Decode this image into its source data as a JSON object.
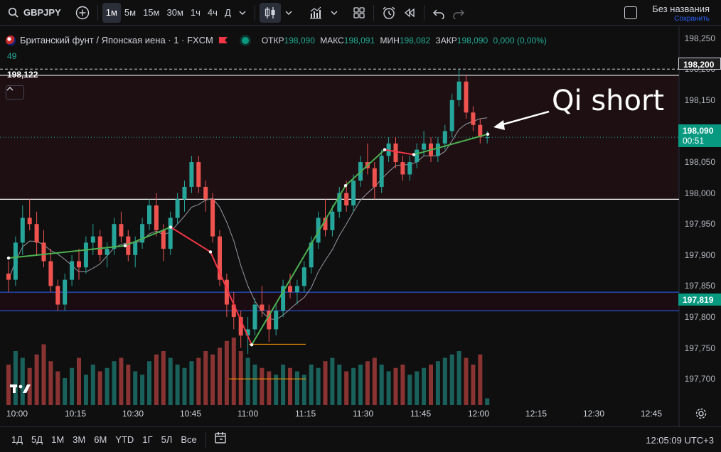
{
  "toolbar": {
    "symbol": "GBPJPY",
    "intervals": [
      "1м",
      "5м",
      "15м",
      "30м",
      "1ч",
      "4ч",
      "Д"
    ],
    "active_interval": "1м",
    "layout_title": "Без названия",
    "layout_subtitle": "Сохранить"
  },
  "legend": {
    "instrument": "Британский фунт / Японская иена · 1 · FXCM",
    "open_label": "ОТКР",
    "open": "198,090",
    "high_label": "МАКС",
    "high": "198,091",
    "low_label": "МИН",
    "low": "198,082",
    "close_label": "ЗАКР",
    "close": "198,090",
    "change": "0,000 (0,00%)",
    "volume": "49"
  },
  "level_label": "198,122",
  "annotation": "Qi short",
  "price_scale": {
    "labels": [
      "198,250",
      "198,200",
      "198,150",
      "198,100",
      "198,050",
      "198,000",
      "197,950",
      "197,900",
      "197,850",
      "197,800",
      "197,750",
      "197,700"
    ],
    "current_price": "198,090",
    "countdown": "00:51",
    "line_price": "197,819",
    "cursor_price": "198,200"
  },
  "time_axis": {
    "labels": [
      "10:00",
      "10:15",
      "10:30",
      "10:45",
      "11:00",
      "11:15",
      "11:30",
      "11:45",
      "12:00",
      "12:15",
      "12:30",
      "12:45"
    ]
  },
  "bottom": {
    "ranges": [
      "1Д",
      "5Д",
      "1М",
      "3М",
      "6М",
      "YTD",
      "1Г",
      "5Л",
      "Все"
    ],
    "clock": "12:05:09 UTC+3"
  },
  "colors": {
    "up": "#26a69a",
    "down": "#ef5350",
    "zigzag_up": "#4caf50",
    "zigzag_down": "#f23645",
    "blue_line": "#2962ff",
    "orange_line": "#ff9800"
  },
  "chart_data": {
    "type": "candlestick",
    "symbol": "GBPJPY",
    "ylim": [
      197.66,
      198.26
    ],
    "candles": [
      [
        197.87,
        197.89,
        197.84,
        197.86
      ],
      [
        197.86,
        197.93,
        197.85,
        197.92
      ],
      [
        197.92,
        197.98,
        197.9,
        197.96
      ],
      [
        197.96,
        197.99,
        197.94,
        197.95
      ],
      [
        197.95,
        197.97,
        197.9,
        197.92
      ],
      [
        197.92,
        197.94,
        197.88,
        197.89
      ],
      [
        197.89,
        197.91,
        197.84,
        197.85
      ],
      [
        197.85,
        197.86,
        197.81,
        197.82
      ],
      [
        197.82,
        197.87,
        197.81,
        197.86
      ],
      [
        197.86,
        197.9,
        197.85,
        197.89
      ],
      [
        197.89,
        197.91,
        197.86,
        197.88
      ],
      [
        197.88,
        197.93,
        197.87,
        197.92
      ],
      [
        197.92,
        197.95,
        197.9,
        197.93
      ],
      [
        197.93,
        197.94,
        197.89,
        197.9
      ],
      [
        197.9,
        197.92,
        197.88,
        197.91
      ],
      [
        197.91,
        197.96,
        197.9,
        197.95
      ],
      [
        197.95,
        197.97,
        197.92,
        197.93
      ],
      [
        197.93,
        197.94,
        197.89,
        197.9
      ],
      [
        197.9,
        197.93,
        197.88,
        197.92
      ],
      [
        197.92,
        197.96,
        197.91,
        197.95
      ],
      [
        197.95,
        197.99,
        197.94,
        197.98
      ],
      [
        197.98,
        198.0,
        197.93,
        197.94
      ],
      [
        197.94,
        197.95,
        197.89,
        197.91
      ],
      [
        197.91,
        197.97,
        197.9,
        197.96
      ],
      [
        197.96,
        198.0,
        197.95,
        197.99
      ],
      [
        197.99,
        198.02,
        197.97,
        198.01
      ],
      [
        198.01,
        198.06,
        198.0,
        198.05
      ],
      [
        198.05,
        198.06,
        198.0,
        198.01
      ],
      [
        198.01,
        198.02,
        197.97,
        197.99
      ],
      [
        197.99,
        198.0,
        197.92,
        197.93
      ],
      [
        197.93,
        197.94,
        197.85,
        197.86
      ],
      [
        197.86,
        197.87,
        197.8,
        197.82
      ],
      [
        197.82,
        197.84,
        197.78,
        197.8
      ],
      [
        197.8,
        197.81,
        197.75,
        197.77
      ],
      [
        197.77,
        197.8,
        197.74,
        197.78
      ],
      [
        197.78,
        197.83,
        197.77,
        197.82
      ],
      [
        197.82,
        197.85,
        197.8,
        197.81
      ],
      [
        197.81,
        197.82,
        197.76,
        197.78
      ],
      [
        197.78,
        197.82,
        197.77,
        197.81
      ],
      [
        197.81,
        197.86,
        197.8,
        197.85
      ],
      [
        197.85,
        197.87,
        197.83,
        197.84
      ],
      [
        197.84,
        197.86,
        197.82,
        197.85
      ],
      [
        197.85,
        197.89,
        197.84,
        197.88
      ],
      [
        197.88,
        197.93,
        197.87,
        197.92
      ],
      [
        197.92,
        197.97,
        197.91,
        197.96
      ],
      [
        197.96,
        197.99,
        197.93,
        197.94
      ],
      [
        197.94,
        197.98,
        197.93,
        197.97
      ],
      [
        197.97,
        198.01,
        197.96,
        198.0
      ],
      [
        198.0,
        198.02,
        197.97,
        197.98
      ],
      [
        197.98,
        198.03,
        197.97,
        198.02
      ],
      [
        198.02,
        198.06,
        198.01,
        198.05
      ],
      [
        198.05,
        198.08,
        198.03,
        198.04
      ],
      [
        198.04,
        198.05,
        197.99,
        198.01
      ],
      [
        198.01,
        198.07,
        198.0,
        198.06
      ],
      [
        198.06,
        198.09,
        198.05,
        198.08
      ],
      [
        198.08,
        198.09,
        198.04,
        198.05
      ],
      [
        198.05,
        198.06,
        198.02,
        198.03
      ],
      [
        198.03,
        198.06,
        198.02,
        198.05
      ],
      [
        198.05,
        198.08,
        198.04,
        198.07
      ],
      [
        198.07,
        198.1,
        198.06,
        198.08
      ],
      [
        198.08,
        198.09,
        198.05,
        198.06
      ],
      [
        198.06,
        198.09,
        198.05,
        198.08
      ],
      [
        198.08,
        198.11,
        198.07,
        198.1
      ],
      [
        198.1,
        198.16,
        198.09,
        198.15
      ],
      [
        198.15,
        198.2,
        198.14,
        198.18
      ],
      [
        198.18,
        198.19,
        198.12,
        198.13
      ],
      [
        198.13,
        198.14,
        198.1,
        198.11
      ],
      [
        198.11,
        198.12,
        198.08,
        198.09
      ],
      [
        198.09,
        198.1,
        198.08,
        198.09
      ]
    ],
    "volumes": [
      60,
      80,
      70,
      55,
      75,
      90,
      65,
      50,
      40,
      55,
      70,
      45,
      60,
      50,
      55,
      65,
      70,
      60,
      50,
      45,
      65,
      75,
      80,
      70,
      60,
      55,
      65,
      70,
      80,
      75,
      85,
      95,
      100,
      80,
      70,
      60,
      55,
      50,
      45,
      60,
      55,
      50,
      45,
      60,
      55,
      65,
      70,
      60,
      50,
      55,
      60,
      65,
      70,
      60,
      50,
      55,
      60,
      45,
      50,
      55,
      60,
      65,
      70,
      75,
      80,
      70,
      60,
      75,
      10
    ],
    "zigzag": [
      [
        12,
        197.895
      ],
      [
        176,
        197.915
      ],
      [
        240,
        197.945
      ],
      [
        296,
        197.905
      ],
      [
        354,
        197.755
      ],
      [
        486,
        198.012
      ],
      [
        541,
        198.07
      ],
      [
        582,
        198.062
      ],
      [
        686,
        198.095
      ]
    ],
    "levels": {
      "white_top": 198.19,
      "white_mid": 197.99,
      "blue_upper": 197.84,
      "blue_lower": 197.81,
      "orange_upper": 197.756,
      "orange_lower": 197.7
    }
  }
}
